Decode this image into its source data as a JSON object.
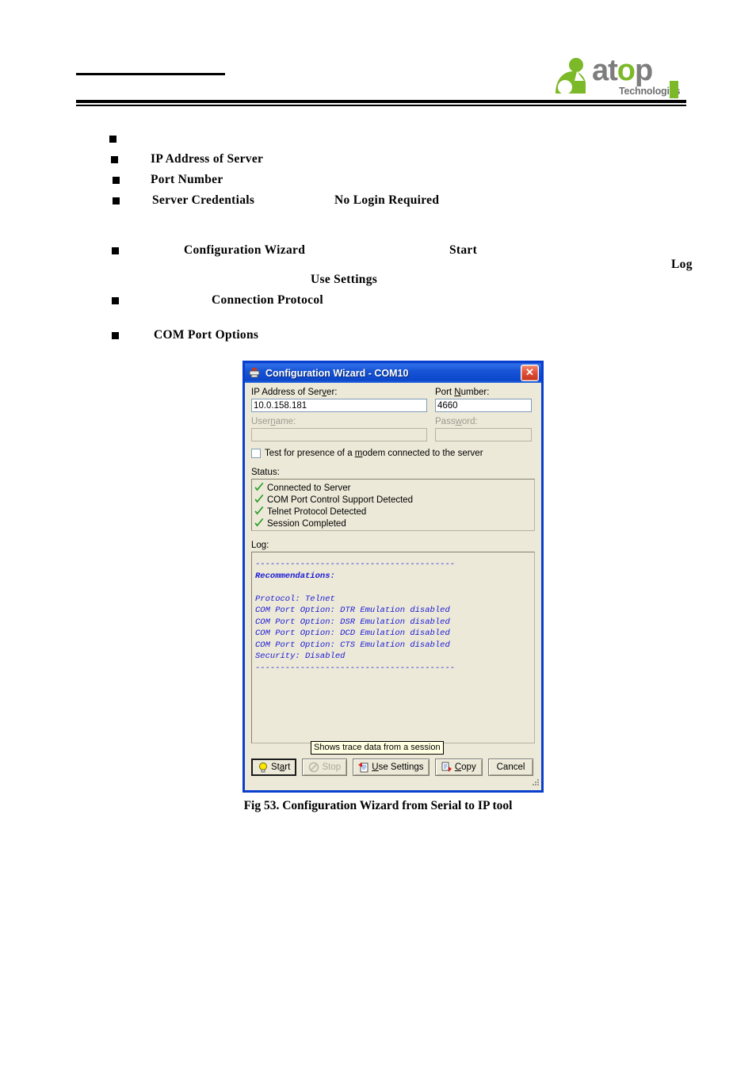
{
  "header": {
    "logo_main": "atop",
    "logo_main_pre": "at",
    "logo_main_o": "o",
    "logo_main_post": "p",
    "logo_sub": "Technologies"
  },
  "bullets": [
    {
      "indent": 0,
      "text": ""
    },
    {
      "indent": 48,
      "text": "IP Address of Server"
    },
    {
      "indent": 48,
      "text": "Port Number"
    },
    {
      "indent": 50,
      "text": "Server  Credentials"
    },
    {
      "indent": 280,
      "text": "No  Login  Required"
    },
    {
      "indent": 90,
      "text": "Configuration  Wizard"
    },
    {
      "indent": 425,
      "text": "Start"
    },
    {
      "indent": 705,
      "text": "Log"
    },
    {
      "indent": 250,
      "text": "Use Settings"
    },
    {
      "indent": 125,
      "text": "Connection Protocol"
    },
    {
      "indent": 52,
      "text": "COM  Port  Options"
    }
  ],
  "dialog": {
    "title": "Configuration Wizard - COM10",
    "title_icon": "printer-icon",
    "close_label": "✕",
    "fields": {
      "ip_label_pre": "IP Address of Ser",
      "ip_label_key": "v",
      "ip_label_post": "er:",
      "ip_value": "10.0.158.181",
      "port_label_pre": "Port ",
      "port_label_key": "N",
      "port_label_post": "umber:",
      "port_value": "4660",
      "username_label_pre": "User",
      "username_label_key": "n",
      "username_label_post": "ame:",
      "username_value": "",
      "password_label_pre": "Pass",
      "password_label_key": "w",
      "password_label_post": "ord:",
      "password_value": ""
    },
    "checkbox": {
      "label_pre": "Test for presence of a ",
      "label_key": "m",
      "label_post": "odem connected to the server",
      "checked": false
    },
    "status": {
      "label": "Status:",
      "items": [
        "Connected to Server",
        "COM Port Control Support Detected",
        "Telnet Protocol Detected",
        "Session Completed"
      ]
    },
    "log": {
      "label": "Log:",
      "lines": [
        {
          "text": "----------------------------------------",
          "bold": false
        },
        {
          "text": "Recommendations:",
          "bold": true
        },
        {
          "text": " ",
          "bold": false
        },
        {
          "text": "Protocol: Telnet",
          "bold": false
        },
        {
          "text": "COM Port Option: DTR Emulation disabled",
          "bold": false
        },
        {
          "text": "COM Port Option: DSR Emulation disabled",
          "bold": false
        },
        {
          "text": "COM Port Option: DCD Emulation disabled",
          "bold": false
        },
        {
          "text": "COM Port Option: CTS Emulation disabled",
          "bold": false
        },
        {
          "text": "Security: Disabled",
          "bold": false
        },
        {
          "text": "----------------------------------------",
          "bold": false
        }
      ]
    },
    "tooltip": "Shows trace data from a session",
    "buttons": {
      "start_pre": "St",
      "start_key": "a",
      "start_post": "rt",
      "stop": "Stop",
      "use_settings_key": "U",
      "use_settings_post": "se Settings",
      "copy_key": "C",
      "copy_post": "opy",
      "cancel": "Cancel"
    }
  },
  "caption": "Fig 53. Configuration Wizard from Serial to IP tool",
  "colors": {
    "titlebar_blue": "#1754d6",
    "dialog_face": "#ece9d8",
    "log_blue": "#1b1bd6",
    "check_green": "#28a028",
    "logo_green": "#7cb928",
    "logo_grey": "#7d7d7d"
  }
}
